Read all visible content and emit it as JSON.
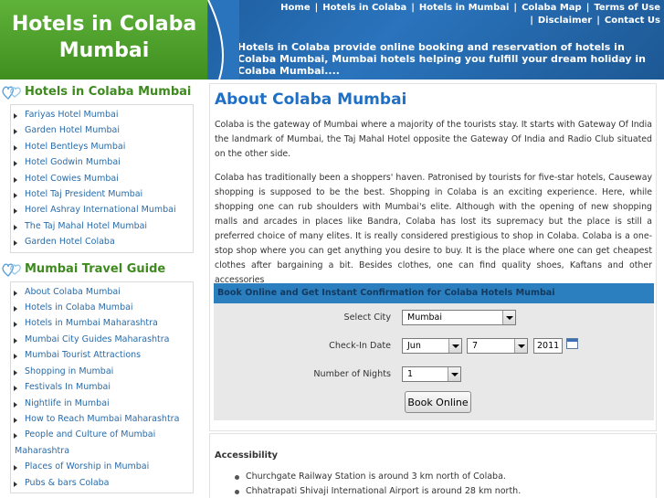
{
  "header": {
    "logo_title_line1": "Hotels in Colaba",
    "logo_title_line2": "Mumbai",
    "nav": [
      "Home",
      "Hotels in Colaba",
      "Hotels in Mumbai",
      "Colaba Map",
      "Terms of Use",
      "Disclaimer",
      "Contact Us"
    ],
    "nav_separator": "|",
    "tagline": "Hotels in Colaba provide online booking and reservation of hotels in Colaba Mumbai, Mumbai hotels helping you fulfill your dream holiday in Colaba Mumbai...."
  },
  "sidebar": {
    "hotels_heading": "Hotels in Colaba Mumbai",
    "hotels": [
      "Fariyas Hotel Mumbai",
      "Garden Hotel Mumbai",
      "Hotel Bentleys Mumbai",
      "Hotel Godwin Mumbai",
      "Hotel Cowies Mumbai",
      "Hotel Taj President Mumbai",
      "Horel Ashray International Mumbai",
      "The Taj Mahal Hotel Mumbai",
      "Garden Hotel Colaba"
    ],
    "guide_heading": "Mumbai Travel Guide",
    "guide": [
      "About Colaba Mumbai",
      "Hotels in Colaba Mumbai",
      "Hotels in Mumbai Maharashtra",
      "Mumbai City Guides Maharashtra",
      "Mumbai Tourist Attractions",
      "Shopping in Mumbai",
      "Festivals In Mumbai",
      "Nightlife in Mumbai",
      "How to Reach Mumbai Maharashtra",
      "People and Culture of Mumbai",
      "Maharashtra",
      "Places of Worship in Mumbai",
      "Pubs & bars Colaba"
    ]
  },
  "main": {
    "title": "About Colaba Mumbai",
    "para1": "Colaba is the gateway of Mumbai where a majority of the tourists stay. It starts with Gateway Of India the landmark of Mumbai, the Taj Mahal Hotel opposite the Gateway Of India and Radio Club situated on the other side.",
    "para2": "Colaba has traditionally been a shoppers' haven. Patronised by tourists for five-star hotels, Causeway shopping is supposed to be the best. Shopping in Colaba is an exciting experience. Here, while shopping one can rub shoulders with Mumbai's elite. Although with the opening of new shopping malls and arcades in places like Bandra, Colaba has lost its supremacy but the place is still a preferred choice of many elites. It is really considered prestigious to shop in Colaba. Colaba is a one-stop shop where you can get anything you desire to buy. It is the place where one can get cheapest clothes after bargaining a bit. Besides clothes, one can find quality shoes, Kaftans and other accessories"
  },
  "booking": {
    "heading": "Book Online and Get Instant Confirmation for Colaba Hotels Mumbai",
    "city_label": "Select City",
    "city_value": "Mumbai",
    "checkin_label": "Check-In Date",
    "month_value": "Jun",
    "day_value": "7",
    "year_value": "2011",
    "nights_label": "Number of Nights",
    "nights_value": "1",
    "button_label": "Book Online"
  },
  "access": {
    "title": "Accessibility",
    "items": [
      "Churchgate Railway Station is around 3 km north of Colaba.",
      "Chhatrapati Shivaji International Airport is around 28 km north."
    ]
  },
  "colors": {
    "logo_green": "#4fa22d",
    "banner_blue": "#2a74bd",
    "heading_blue": "#1f6fc4",
    "link_blue": "#2a6ba8"
  }
}
